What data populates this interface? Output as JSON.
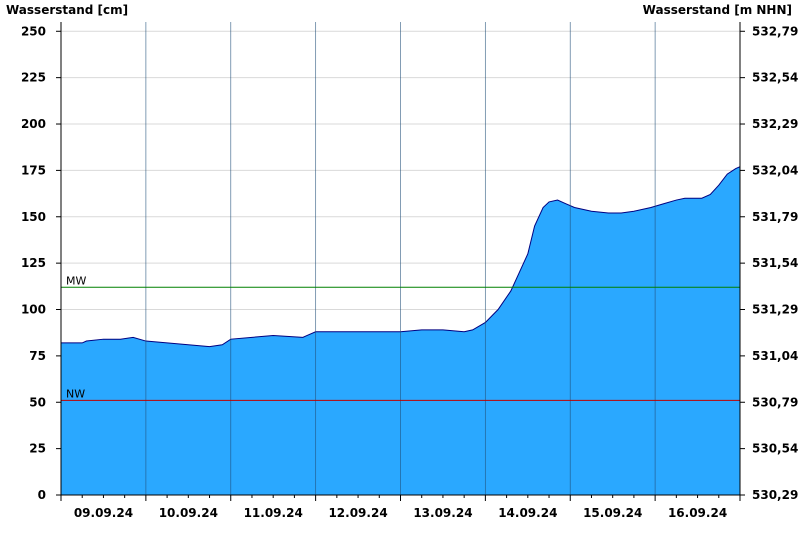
{
  "chart_data": {
    "type": "area",
    "left_axis_label": "Wasserstand [cm]",
    "right_axis_label": "Wasserstand [m NHN]",
    "ylim": [
      0,
      255
    ],
    "y_ticks": [
      0,
      25,
      50,
      75,
      100,
      125,
      150,
      175,
      200,
      225,
      250
    ],
    "right_ticks": [
      "530,29",
      "530,54",
      "530,79",
      "531,04",
      "531,29",
      "531,54",
      "531,79",
      "532,04",
      "532,29",
      "532,54",
      "532,79"
    ],
    "x_day_labels": [
      "09.09.24",
      "10.09.24",
      "11.09.24",
      "12.09.24",
      "13.09.24",
      "14.09.24",
      "15.09.24",
      "16.09.24"
    ],
    "xlim_days": [
      0,
      8
    ],
    "grid": true,
    "fill_color": "#2aa8ff",
    "line_color": "#000080",
    "reference_lines": [
      {
        "label": "MW",
        "value": 112,
        "color": "#008000"
      },
      {
        "label": "NW",
        "value": 51,
        "color": "#c00000"
      }
    ],
    "series": [
      {
        "x_days": [
          0,
          0.25,
          0.3,
          0.5,
          0.7,
          0.85,
          1.0,
          1.25,
          1.5,
          1.75,
          1.9,
          2.0,
          2.25,
          2.5,
          2.85,
          2.9,
          3.0,
          3.25,
          3.5,
          3.75,
          4.0,
          4.25,
          4.5,
          4.75,
          4.85,
          5.0,
          5.15,
          5.3,
          5.4,
          5.5,
          5.58,
          5.68,
          5.75,
          5.85,
          5.95,
          6.05,
          6.25,
          6.45,
          6.6,
          6.75,
          6.85,
          6.95,
          7.1,
          7.25,
          7.35,
          7.45,
          7.55,
          7.65,
          7.75,
          7.85,
          7.95,
          8.0
        ],
        "y": [
          82,
          82,
          83,
          84,
          84,
          85,
          83,
          82,
          81,
          80,
          81,
          84,
          85,
          86,
          85,
          86,
          88,
          88,
          88,
          88,
          88,
          89,
          89,
          88,
          89,
          93,
          100,
          110,
          120,
          130,
          145,
          155,
          158,
          159,
          157,
          155,
          153,
          152,
          152,
          153,
          154,
          155,
          157,
          159,
          160,
          160,
          160,
          162,
          167,
          173,
          176,
          177
        ]
      }
    ]
  }
}
